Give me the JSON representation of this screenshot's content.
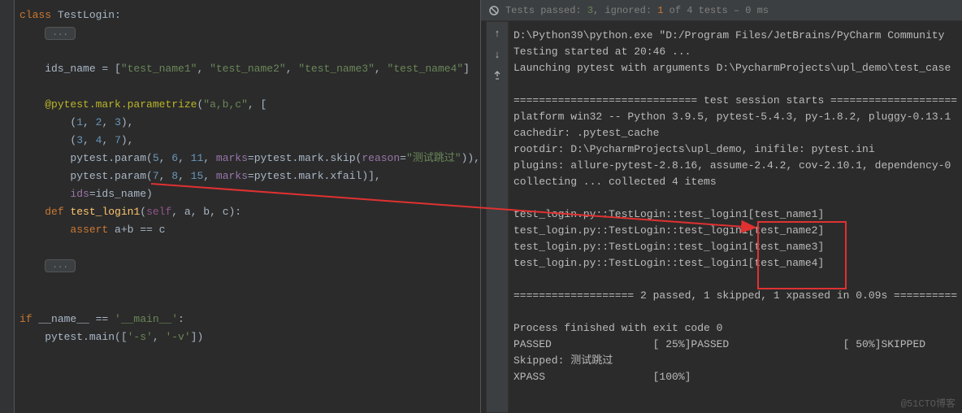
{
  "editor": {
    "class_kw": "class",
    "class_name": "TestLogin",
    "fold": "...",
    "ids_line_prefix": "ids_name = [",
    "ids_items": [
      "\"test_name1\"",
      "\"test_name2\"",
      "\"test_name3\"",
      "\"test_name4\""
    ],
    "ids_line_suffix": "]",
    "decorator": "@pytest.mark.parametrize",
    "param_str": "\"a,b,c\"",
    "tuple1": "(1, 2, 3),",
    "tuple2": "(3, 4, 7),",
    "param_call1_a": "pytest.param(",
    "param_call1_nums": "5, 6, 11",
    "marks_kw": "marks",
    "param_call1_b": "=pytest.mark.skip(",
    "reason_kw": "reason",
    "reason_val": "\"测试跳过\"",
    "param_call1_c": ")),",
    "param_call2_a": "pytest.param(",
    "param_call2_nums": "7, 8, 15",
    "param_call2_b": "=pytest.mark.xfail)],",
    "ids_assign": "ids",
    "ids_assign_val": "=ids_name)",
    "def_kw": "def",
    "fn_name": "test_login1",
    "fn_params": "(self, a, b, c):",
    "assert_kw": "assert",
    "assert_expr": " a+b == c",
    "if_kw": "if",
    "name_dunder": "__name__",
    "eq": " == ",
    "main_str": "'__main__'",
    "main_call": "pytest.main([",
    "main_args": "'-s', '-v'",
    "main_close": "])"
  },
  "run": {
    "header_prefix": "Tests passed: ",
    "passed_count": "3",
    "ignored_label": ", ignored: ",
    "ignored_count": "1",
    "of_tests": " of 4 tests",
    "time": " – 0 ms",
    "lines": [
      "D:\\Python39\\python.exe \"D:/Program Files/JetBrains/PyCharm Community ",
      "Testing started at 20:46 ...",
      "Launching pytest with arguments D:\\PycharmProjects\\upl_demo\\test_case",
      "",
      "============================= test session starts ====================",
      "platform win32 -- Python 3.9.5, pytest-5.4.3, py-1.8.2, pluggy-0.13.1",
      "cachedir: .pytest_cache",
      "rootdir: D:\\PycharmProjects\\upl_demo, inifile: pytest.ini",
      "plugins: allure-pytest-2.8.16, assume-2.4.2, cov-2.10.1, dependency-0",
      "collecting ... collected 4 items",
      "",
      "test_login.py::TestLogin::test_login1[test_name1] ",
      "test_login.py::TestLogin::test_login1[test_name2] ",
      "test_login.py::TestLogin::test_login1[test_name3] ",
      "test_login.py::TestLogin::test_login1[test_name4] ",
      "",
      "=================== 2 passed, 1 skipped, 1 xpassed in 0.09s ==========",
      "",
      "Process finished with exit code 0",
      "PASSED                [ 25%]PASSED                  [ 50%]SKIPPED",
      "Skipped: 测试跳过",
      "XPASS                 [100%]"
    ]
  },
  "watermark": "@51CTO博客"
}
